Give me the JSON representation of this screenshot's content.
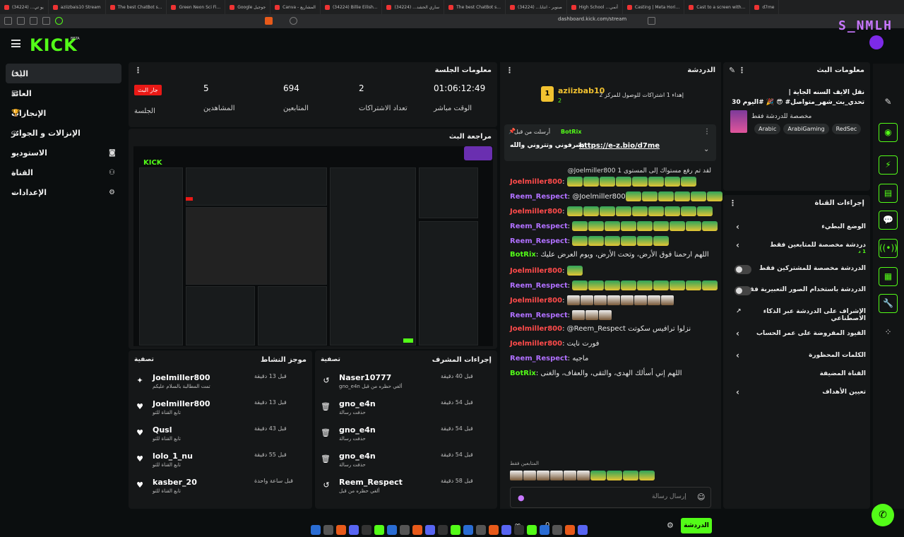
{
  "browser": {
    "tabs": [
      {
        "label": "(34224) ‫يو تي..."
      },
      {
        "label": "aziizbais10 Stream"
      },
      {
        "label": "The best ChatBot s..."
      },
      {
        "label": "Green Neon Sci Fi..."
      },
      {
        "label": "Google ‫جوجيل"
      },
      {
        "label": "Canva - ‫المشاريع"
      },
      {
        "label": "(34224) Billie Eilish..."
      },
      {
        "label": "(34224) ‫ساري الحشد..."
      },
      {
        "label": "The best ChatBot s..."
      },
      {
        "label": "(34224) ‫صنوير - ‫انتابا..."
      },
      {
        "label": "High School ‫أنمي..."
      },
      {
        "label": "Casting | Meta Hori..."
      },
      {
        "label": "Cast to a screen with..."
      },
      {
        "label": "d7me"
      }
    ],
    "url": "dashboard.kick.com/stream"
  },
  "overlay": {
    "brand": "S_NMLH"
  },
  "app": {
    "logo": "KICK",
    "beta": "BETA"
  },
  "sidebar": {
    "items": [
      {
        "label": "البث",
        "icon": "broadcast-icon",
        "glyph": "(•)"
      },
      {
        "label": "العائد",
        "icon": "revenue-icon",
        "glyph": "▤"
      },
      {
        "label": "الإنجازات",
        "icon": "trophy-icon",
        "glyph": "🏆"
      },
      {
        "label": "الإنزالات و الجوائز",
        "icon": "drops-icon",
        "glyph": "⛀"
      },
      {
        "label": "الاستوديو",
        "icon": "studio-icon",
        "glyph": "⌄",
        "right": "◙"
      },
      {
        "label": "القناة",
        "icon": "channel-icon",
        "glyph": "⌄",
        "right": "⚇"
      },
      {
        "label": "الإعدادات",
        "icon": "settings-icon",
        "glyph": "⌄",
        "right": "⚙"
      }
    ]
  },
  "session": {
    "title": "معلومات الجلسة",
    "live_badge": "جار البث",
    "session_label": "الجلسة",
    "stats": [
      {
        "value": "5",
        "label": "المشاهدين"
      },
      {
        "value": "694",
        "label": "المتابعين"
      },
      {
        "value": "2",
        "label": "تعداد الاشتراكات"
      },
      {
        "value": "01:06:12:49",
        "label": "الوقت مباشر"
      }
    ]
  },
  "preview": {
    "title": "مراجعة البث"
  },
  "activity": {
    "title": "موجز النشاط",
    "filter": "تصفية",
    "items": [
      {
        "name": "Joelmiller800",
        "sub": "تمت المطالبة بالسلام عليكم",
        "sub_highlight": "السلام عليكم",
        "time": "قبل 13 دقيقة",
        "icon": "gift-icon",
        "glyph": "✦"
      },
      {
        "name": "Joelmiller800",
        "sub": "تابع القناة للتو",
        "time": "قبل 13 دقيقة",
        "icon": "heart-icon",
        "glyph": "♥"
      },
      {
        "name": "Qusl",
        "sub": "تابع القناة للتو",
        "time": "قبل 43 دقيقة",
        "icon": "heart-icon",
        "glyph": "♥"
      },
      {
        "name": "lolo_1_nu",
        "sub": "تابع القناة للتو",
        "time": "قبل 55 دقيقة",
        "icon": "heart-icon",
        "glyph": "♥"
      },
      {
        "name": "kasber_20",
        "sub": "تابع القناة للتو",
        "time": "قبل ساعة واحدة",
        "icon": "heart-icon",
        "glyph": "♥"
      }
    ]
  },
  "modactions": {
    "title": "إجراءات المشرف",
    "filter": "تصفية",
    "items": [
      {
        "name": "Naser10777",
        "sub": "ألغي حظره من قبل gno_e4n",
        "time": "قبل 40 دقيقة",
        "icon": "undo-icon",
        "glyph": "↺"
      },
      {
        "name": "gno_e4n",
        "sub": "حذفت رسالة",
        "time": "قبل 54 دقيقة",
        "icon": "trash-icon",
        "glyph": "🗑"
      },
      {
        "name": "gno_e4n",
        "sub": "حذفت رسالة",
        "time": "قبل 54 دقيقة",
        "icon": "trash-icon",
        "glyph": "🗑"
      },
      {
        "name": "gno_e4n",
        "sub": "حذفت رسالة",
        "time": "قبل 54 دقيقة",
        "icon": "trash-icon",
        "glyph": "🗑"
      },
      {
        "name": "Reem_Respect",
        "sub": "ألغي حظره من قبل",
        "time": "قبل 58 دقيقة",
        "icon": "undo-icon",
        "glyph": "↺"
      }
    ]
  },
  "chat": {
    "title": "الدردشة",
    "top_user": "aziizbab10",
    "top_rank": "1",
    "top_count": "2",
    "goal_text": "إهداء 1 اشتراكات للوصول للمركز 2",
    "pinned_label": "أرسلت من قبل",
    "pinned_user": "BotRix",
    "pinned_text": "تشرفوني وتتروني والله",
    "pinned_link": "https://e-z.bio/d7me",
    "system_msg": "لقد تم رفع مستواك إلى المستوى 1 ‎@Joelmiller800",
    "messages": [
      {
        "user": "Joelmiller800",
        "cls": "u1",
        "emotes": 8
      },
      {
        "user": "Reem_Respect",
        "cls": "u2",
        "text": "@Joelmiller800",
        "emotes": 6
      },
      {
        "user": "Joelmiller800",
        "cls": "u1",
        "emotes": 9
      },
      {
        "user": "Reem_Respect",
        "cls": "u2",
        "emotes": 9
      },
      {
        "user": "Reem_Respect",
        "cls": "u2",
        "emotes": 6
      },
      {
        "user": "BotRix",
        "cls": "u3",
        "text": "اللهم ارحمنا فوق الأرض، وتحت الأرض، ويوم العرض عليك"
      },
      {
        "user": "Joelmiller800",
        "cls": "u1",
        "emotes": 1
      },
      {
        "user": "Reem_Respect",
        "cls": "u2",
        "emotes": 9
      },
      {
        "user": "Joelmiller800",
        "cls": "u1",
        "emotes2": 8
      },
      {
        "user": "Reem_Respect",
        "cls": "u2",
        "emotes2": 3
      },
      {
        "user": "Joelmiller800",
        "cls": "u1",
        "text": "@Reem_Respect نزلوا ترافيس سكوتت"
      },
      {
        "user": "Joelmiller800",
        "cls": "u1",
        "text": "فورت نايت"
      },
      {
        "user": "Reem_Respect",
        "cls": "u2",
        "text": "ماجيه"
      },
      {
        "user": "BotRix",
        "cls": "u3",
        "text": "اللهم إني أسألك الهدى، والتقى، والعفاف، والغنى"
      }
    ],
    "followers_only": "المتابعين فقط",
    "input_placeholder": "إرسال رسالة",
    "send_label": "الدردشة",
    "bottom_count": "0"
  },
  "streaminfo": {
    "title": "معلومات البث",
    "stream_title": "نقل الايف السنه الجاية | تحدي_بث_شهر_متواصل# 😎 🎉 #اليوم 30",
    "category": "مخصصة للدردشة فقط",
    "tags": [
      "Arabic",
      "ArabiGaming",
      "RedSec"
    ]
  },
  "channelactions": {
    "title": "إجراءات القناة",
    "items": [
      {
        "label": "الوضع البطيء",
        "type": "chevron"
      },
      {
        "label": "دردشة مخصصة للمتابعين فقط",
        "extra": "1 د",
        "type": "chevron"
      },
      {
        "label": "الدردشة مخصصة للمشتركين فقط",
        "type": "toggle"
      },
      {
        "label": "الدردشة باستخدام الصور التعبيرية فقط",
        "type": "toggle"
      },
      {
        "label": "الإشراف على الدردشة عبر الذكاء الاصطناعي",
        "type": "link"
      },
      {
        "label": "القيود المفروضة على عمر الحساب",
        "type": "chevron"
      },
      {
        "label": "الكلمات المحظورة",
        "type": "chevron"
      },
      {
        "label": "القناة المضيفة",
        "type": "header"
      },
      {
        "label": "تعيين الأهداف",
        "type": "chevron"
      }
    ]
  },
  "rail": {
    "buttons": [
      {
        "icon": "pencil-icon",
        "glyph": "✎"
      },
      {
        "icon": "camera-icon",
        "glyph": "◉"
      },
      {
        "icon": "bolt-icon",
        "glyph": "⚡"
      },
      {
        "icon": "document-icon",
        "glyph": "▤"
      },
      {
        "icon": "chat-icon",
        "glyph": "💬"
      },
      {
        "icon": "broadcast-icon",
        "glyph": "((•))"
      },
      {
        "icon": "layout-icon",
        "glyph": "▦"
      },
      {
        "icon": "wrench-icon",
        "glyph": "🔧"
      },
      {
        "icon": "dots-icon",
        "glyph": "⁘"
      }
    ]
  },
  "colors": {
    "accent": "#53fc18",
    "live": "#e91916",
    "panel": "#151718"
  }
}
